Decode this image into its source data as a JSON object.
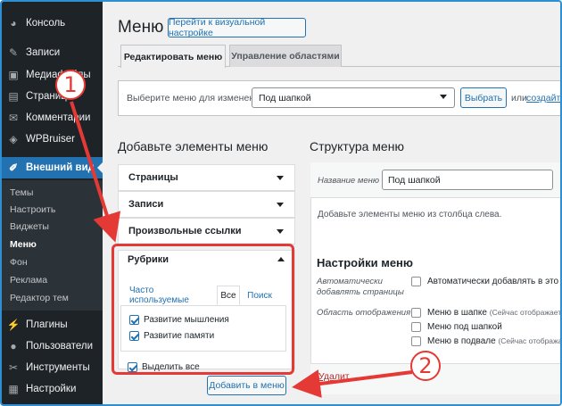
{
  "sidebar": {
    "items": [
      {
        "label": "Консоль",
        "icon": "dashboard-icon",
        "glyph": "◕"
      },
      {
        "label": "Записи",
        "icon": "pin-icon",
        "glyph": "✎"
      },
      {
        "label": "Медиафайлы",
        "icon": "media-icon",
        "glyph": "▣"
      },
      {
        "label": "Страницы",
        "icon": "pages-icon",
        "glyph": "▤"
      },
      {
        "label": "Комментарии",
        "icon": "comments-icon",
        "glyph": "✉"
      },
      {
        "label": "WPBruiser",
        "icon": "shield-icon",
        "glyph": "◈"
      },
      {
        "label": "Внешний вид",
        "icon": "paintbrush-icon",
        "glyph": "✐"
      },
      {
        "label": "Плагины",
        "icon": "plugins-icon",
        "glyph": "⚡"
      },
      {
        "label": "Пользователи",
        "icon": "users-icon",
        "glyph": "●"
      },
      {
        "label": "Инструменты",
        "icon": "tools-icon",
        "glyph": "✂"
      },
      {
        "label": "Настройки",
        "icon": "settings-icon",
        "glyph": "▦"
      }
    ],
    "submenu": [
      "Темы",
      "Настроить",
      "Виджеты",
      "Меню",
      "Фон",
      "Реклама",
      "Редактор тем"
    ]
  },
  "header": {
    "title": "Меню",
    "visual_button": "Перейти к визуальной настройке"
  },
  "tabs": [
    "Редактировать меню",
    "Управление областями"
  ],
  "select_bar": {
    "prompt": "Выберите меню для изменения:",
    "selected": "Под шапкой",
    "select_button": "Выбрать",
    "or_text": "или",
    "create_link": "создайте"
  },
  "add_items": {
    "title": "Добавьте элементы меню",
    "sections": [
      "Страницы",
      "Записи",
      "Произвольные ссылки",
      "Рубрики"
    ],
    "inner_tabs": [
      "Часто используемые",
      "Все",
      "Поиск"
    ],
    "checkboxes": [
      {
        "label": "Развитие мышления",
        "checked": true
      },
      {
        "label": "Развитие памяти",
        "checked": true
      }
    ],
    "select_all": "Выделить все",
    "add_button": "Добавить в меню"
  },
  "structure": {
    "title": "Структура меню",
    "name_label": "Название меню",
    "name_value": "Под шапкой",
    "hint": "Добавьте элементы меню из столбца слева.",
    "settings_title": "Настройки меню",
    "auto_label_1": "Автоматически",
    "auto_label_2": "добавлять страницы",
    "auto_option": "Автоматически добавлять в это ме",
    "area_label": "Область отображения",
    "areas": [
      {
        "label": "Меню в шапке",
        "note": "(Сейчас отображает ме"
      },
      {
        "label": "Меню под шапкой",
        "note": ""
      },
      {
        "label": "Меню в подвале",
        "note": "(Сейчас отображает ме"
      }
    ],
    "delete_link": "Удалит"
  },
  "annotations": {
    "badge_1": "1",
    "badge_2": "2",
    "color": "#e53935"
  },
  "colors": {
    "accent": "#2271b1",
    "sidebar_bg": "#1d2327"
  }
}
